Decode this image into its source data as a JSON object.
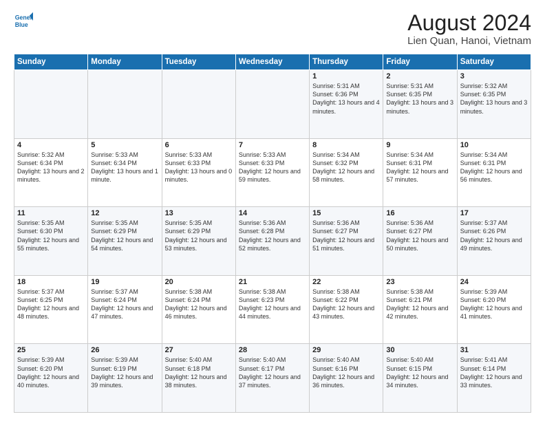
{
  "header": {
    "logo_line1": "General",
    "logo_line2": "Blue",
    "title": "August 2024",
    "subtitle": "Lien Quan, Hanoi, Vietnam"
  },
  "weekdays": [
    "Sunday",
    "Monday",
    "Tuesday",
    "Wednesday",
    "Thursday",
    "Friday",
    "Saturday"
  ],
  "weeks": [
    [
      {
        "day": "",
        "info": ""
      },
      {
        "day": "",
        "info": ""
      },
      {
        "day": "",
        "info": ""
      },
      {
        "day": "",
        "info": ""
      },
      {
        "day": "1",
        "info": "Sunrise: 5:31 AM\nSunset: 6:36 PM\nDaylight: 13 hours\nand 4 minutes."
      },
      {
        "day": "2",
        "info": "Sunrise: 5:31 AM\nSunset: 6:35 PM\nDaylight: 13 hours\nand 3 minutes."
      },
      {
        "day": "3",
        "info": "Sunrise: 5:32 AM\nSunset: 6:35 PM\nDaylight: 13 hours\nand 3 minutes."
      }
    ],
    [
      {
        "day": "4",
        "info": "Sunrise: 5:32 AM\nSunset: 6:34 PM\nDaylight: 13 hours\nand 2 minutes."
      },
      {
        "day": "5",
        "info": "Sunrise: 5:33 AM\nSunset: 6:34 PM\nDaylight: 13 hours\nand 1 minute."
      },
      {
        "day": "6",
        "info": "Sunrise: 5:33 AM\nSunset: 6:33 PM\nDaylight: 13 hours\nand 0 minutes."
      },
      {
        "day": "7",
        "info": "Sunrise: 5:33 AM\nSunset: 6:33 PM\nDaylight: 12 hours\nand 59 minutes."
      },
      {
        "day": "8",
        "info": "Sunrise: 5:34 AM\nSunset: 6:32 PM\nDaylight: 12 hours\nand 58 minutes."
      },
      {
        "day": "9",
        "info": "Sunrise: 5:34 AM\nSunset: 6:31 PM\nDaylight: 12 hours\nand 57 minutes."
      },
      {
        "day": "10",
        "info": "Sunrise: 5:34 AM\nSunset: 6:31 PM\nDaylight: 12 hours\nand 56 minutes."
      }
    ],
    [
      {
        "day": "11",
        "info": "Sunrise: 5:35 AM\nSunset: 6:30 PM\nDaylight: 12 hours\nand 55 minutes."
      },
      {
        "day": "12",
        "info": "Sunrise: 5:35 AM\nSunset: 6:29 PM\nDaylight: 12 hours\nand 54 minutes."
      },
      {
        "day": "13",
        "info": "Sunrise: 5:35 AM\nSunset: 6:29 PM\nDaylight: 12 hours\nand 53 minutes."
      },
      {
        "day": "14",
        "info": "Sunrise: 5:36 AM\nSunset: 6:28 PM\nDaylight: 12 hours\nand 52 minutes."
      },
      {
        "day": "15",
        "info": "Sunrise: 5:36 AM\nSunset: 6:27 PM\nDaylight: 12 hours\nand 51 minutes."
      },
      {
        "day": "16",
        "info": "Sunrise: 5:36 AM\nSunset: 6:27 PM\nDaylight: 12 hours\nand 50 minutes."
      },
      {
        "day": "17",
        "info": "Sunrise: 5:37 AM\nSunset: 6:26 PM\nDaylight: 12 hours\nand 49 minutes."
      }
    ],
    [
      {
        "day": "18",
        "info": "Sunrise: 5:37 AM\nSunset: 6:25 PM\nDaylight: 12 hours\nand 48 minutes."
      },
      {
        "day": "19",
        "info": "Sunrise: 5:37 AM\nSunset: 6:24 PM\nDaylight: 12 hours\nand 47 minutes."
      },
      {
        "day": "20",
        "info": "Sunrise: 5:38 AM\nSunset: 6:24 PM\nDaylight: 12 hours\nand 46 minutes."
      },
      {
        "day": "21",
        "info": "Sunrise: 5:38 AM\nSunset: 6:23 PM\nDaylight: 12 hours\nand 44 minutes."
      },
      {
        "day": "22",
        "info": "Sunrise: 5:38 AM\nSunset: 6:22 PM\nDaylight: 12 hours\nand 43 minutes."
      },
      {
        "day": "23",
        "info": "Sunrise: 5:38 AM\nSunset: 6:21 PM\nDaylight: 12 hours\nand 42 minutes."
      },
      {
        "day": "24",
        "info": "Sunrise: 5:39 AM\nSunset: 6:20 PM\nDaylight: 12 hours\nand 41 minutes."
      }
    ],
    [
      {
        "day": "25",
        "info": "Sunrise: 5:39 AM\nSunset: 6:20 PM\nDaylight: 12 hours\nand 40 minutes."
      },
      {
        "day": "26",
        "info": "Sunrise: 5:39 AM\nSunset: 6:19 PM\nDaylight: 12 hours\nand 39 minutes."
      },
      {
        "day": "27",
        "info": "Sunrise: 5:40 AM\nSunset: 6:18 PM\nDaylight: 12 hours\nand 38 minutes."
      },
      {
        "day": "28",
        "info": "Sunrise: 5:40 AM\nSunset: 6:17 PM\nDaylight: 12 hours\nand 37 minutes."
      },
      {
        "day": "29",
        "info": "Sunrise: 5:40 AM\nSunset: 6:16 PM\nDaylight: 12 hours\nand 36 minutes."
      },
      {
        "day": "30",
        "info": "Sunrise: 5:40 AM\nSunset: 6:15 PM\nDaylight: 12 hours\nand 34 minutes."
      },
      {
        "day": "31",
        "info": "Sunrise: 5:41 AM\nSunset: 6:14 PM\nDaylight: 12 hours\nand 33 minutes."
      }
    ]
  ]
}
